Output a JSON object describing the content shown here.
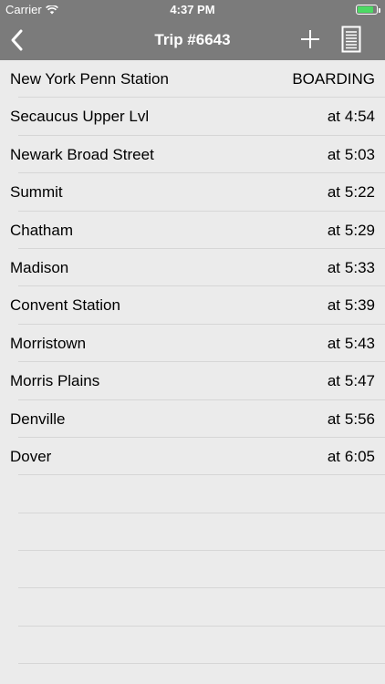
{
  "status_bar": {
    "carrier": "Carrier",
    "time": "4:37 PM",
    "wifi_icon": "wifi-icon",
    "battery_icon": "battery-icon",
    "battery_level": 0.85,
    "battery_color": "#4cd964"
  },
  "nav": {
    "title": "Trip #6643",
    "back_icon": "chevron-left-icon",
    "add_icon": "plus-icon",
    "document_icon": "document-icon"
  },
  "stops": [
    {
      "station": "New York Penn Station",
      "at": "",
      "time": "BOARDING"
    },
    {
      "station": "Secaucus Upper Lvl",
      "at": "at",
      "time": "4:54"
    },
    {
      "station": "Newark Broad Street",
      "at": "at",
      "time": "5:03"
    },
    {
      "station": "Summit",
      "at": "at",
      "time": "5:22"
    },
    {
      "station": "Chatham",
      "at": "at",
      "time": "5:29"
    },
    {
      "station": "Madison",
      "at": "at",
      "time": "5:33"
    },
    {
      "station": "Convent Station",
      "at": "at",
      "time": "5:39"
    },
    {
      "station": "Morristown",
      "at": "at",
      "time": "5:43"
    },
    {
      "station": "Morris Plains",
      "at": "at",
      "time": "5:47"
    },
    {
      "station": "Denville",
      "at": "at",
      "time": "5:56"
    },
    {
      "station": "Dover",
      "at": "at",
      "time": "6:05"
    }
  ],
  "empty_rows": 5,
  "colors": {
    "nav_background": "#7b7b7b",
    "list_background": "#ebebeb",
    "separator": "#d6d6d6"
  }
}
